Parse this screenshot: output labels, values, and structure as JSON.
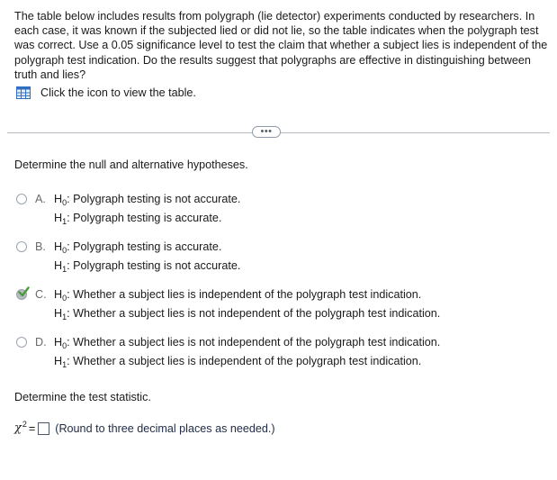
{
  "problem": {
    "text": "The table below includes results from polygraph (lie detector) experiments conducted by researchers. In each case, it was known if the subjected lied or did not lie, so the table indicates when the polygraph test was correct. Use a 0.05 significance level to test the claim that whether a subject lies is independent of the polygraph test indication. Do the results suggest that polygraphs are effective in distinguishing between truth and lies?"
  },
  "table_link": {
    "icon": "table-grid-icon",
    "label": "Click the icon to view the table."
  },
  "divider": {
    "button_label": "•••"
  },
  "question1": {
    "prompt": "Determine the null and alternative hypotheses.",
    "options": [
      {
        "letter": "A.",
        "h0_label": "H",
        "h0_sub": "0",
        "h0_text": ": Polygraph testing is not accurate.",
        "h1_label": "H",
        "h1_sub": "1",
        "h1_text": ": Polygraph testing is accurate.",
        "selected": false
      },
      {
        "letter": "B.",
        "h0_label": "H",
        "h0_sub": "0",
        "h0_text": ": Polygraph testing is accurate.",
        "h1_label": "H",
        "h1_sub": "1",
        "h1_text": ": Polygraph testing is not accurate.",
        "selected": false
      },
      {
        "letter": "C.",
        "h0_label": "H",
        "h0_sub": "0",
        "h0_text": ": Whether a subject lies is independent of the polygraph test indication.",
        "h1_label": "H",
        "h1_sub": "1",
        "h1_text": ": Whether a subject lies is not independent of the polygraph test indication.",
        "selected": true
      },
      {
        "letter": "D.",
        "h0_label": "H",
        "h0_sub": "0",
        "h0_text": ": Whether a subject lies is not independent of the polygraph test indication.",
        "h1_label": "H",
        "h1_sub": "1",
        "h1_text": ": Whether a subject lies is independent of the polygraph test indication.",
        "selected": false
      }
    ]
  },
  "question2": {
    "prompt": "Determine the test statistic.",
    "symbol": "χ",
    "superscript": "2",
    "equals": "=",
    "answer_value": "",
    "hint": "(Round to three decimal places as needed.)"
  },
  "colors": {
    "text": "#1a1a1a",
    "check_green": "#4a9a3c",
    "table_icon_blue": "#2f6fbf"
  }
}
